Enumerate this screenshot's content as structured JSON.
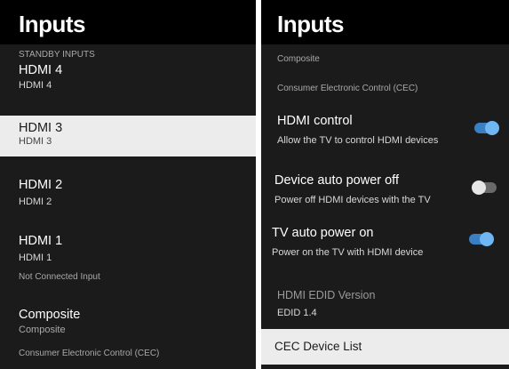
{
  "left": {
    "title": "Inputs",
    "section_label": "STANDBY INPUTS",
    "items": [
      {
        "title": "HDMI 4",
        "subtitle": "HDMI 4"
      },
      {
        "title": "HDMI 3",
        "subtitle": "HDMI 3"
      },
      {
        "title": "HDMI 2",
        "subtitle": "HDMI 2"
      },
      {
        "title": "HDMI 1",
        "subtitle": "HDMI 1"
      },
      {
        "title": "Composite",
        "subtitle": "Composite"
      }
    ],
    "not_connected_label": "Not Connected Input",
    "cec_label": "Consumer Electronic Control (CEC)"
  },
  "right": {
    "title": "Inputs",
    "top_label": "Composite",
    "cec_label": "Consumer Electronic Control (CEC)",
    "settings": [
      {
        "title": "HDMI control",
        "subtitle": "Allow the TV to control HDMI devices",
        "state": "on"
      },
      {
        "title": "Device auto power off",
        "subtitle": "Power off HDMI devices with the TV",
        "state": "off"
      },
      {
        "title": "TV auto power on",
        "subtitle": "Power on the TV with HDMI device",
        "state": "on"
      }
    ],
    "edid": {
      "title": "HDMI EDID Version",
      "value": "EDID 1.4"
    },
    "cec_device_list": "CEC Device List"
  },
  "colors": {
    "toggle_on": "#3a7fc1",
    "toggle_off": "#6a6a6a",
    "panel_bg": "#1b1b1b",
    "selection_bg": "#ececec"
  }
}
